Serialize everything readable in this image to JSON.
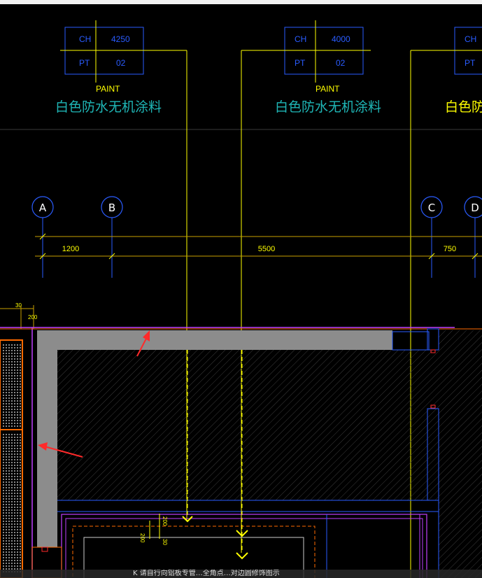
{
  "drawing": {
    "tags": [
      {
        "ch_label": "CH",
        "ch_value": "4250",
        "pt_label": "PT",
        "pt_value": "02",
        "material_code": "PAINT",
        "material_name": "白色防水无机涂料"
      },
      {
        "ch_label": "CH",
        "ch_value": "4000",
        "pt_label": "PT",
        "pt_value": "02",
        "material_code": "PAINT",
        "material_name": "白色防水无机涂料"
      },
      {
        "ch_label": "CH",
        "pt_label": "PT",
        "material_name": "白色防"
      }
    ],
    "grid_axes": [
      "A",
      "B",
      "C",
      "D"
    ],
    "dimensions": {
      "ab": "1200",
      "bc": "5500",
      "cd": "750"
    },
    "small_dims": {
      "d30": "30",
      "d200": "200",
      "d_vert_200a": "200",
      "d_vert_200b": "200",
      "d_vert_30": "30"
    },
    "colors": {
      "cyan_text": "#1fb7b7",
      "yellow": "#ffff00",
      "blue": "#2a5cff",
      "magenta": "#c040ff",
      "orange": "#ff6a00",
      "gray_fill": "#8c8c8c",
      "red_arrow": "#ff2a2a"
    }
  },
  "status": {
    "message": "K 请自行向铝板专管…全角点…对边圆修饰图示"
  }
}
